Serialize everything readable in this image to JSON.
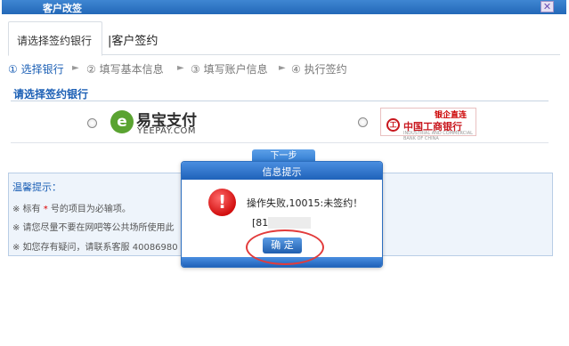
{
  "window": {
    "title": "客户改签",
    "close_glyph": "✕"
  },
  "tabs": [
    {
      "label": "请选择签约银行"
    },
    {
      "label": "|客户签约"
    }
  ],
  "steps": [
    {
      "label": "① 选择银行"
    },
    {
      "label": "② 填写基本信息"
    },
    {
      "label": "③ 填写账户信息"
    },
    {
      "label": "④ 执行签约"
    }
  ],
  "step_arrow": "►",
  "bank_section": {
    "title": "请选择签约银行"
  },
  "banks": [
    {
      "logo_mark": "e",
      "name": "易宝支付",
      "sub": "YEEPAY.COM"
    },
    {
      "top_tag": "银企直连",
      "logo_mark": "工",
      "name": "中国工商银行",
      "sub": "INDUSTRIAL AND COMMERCIAL BANK OF CHINA"
    }
  ],
  "next_button": "下一步",
  "tips": {
    "title": "温馨提示：",
    "lines": [
      {
        "prefix": "※ 标有",
        "star": " * ",
        "suffix": "号的项目为必输项。"
      },
      {
        "text": "※ 请您尽量不要在网吧等公共场所使用此"
      },
      {
        "text": "※ 如您存有疑问，请联系客服 40086980"
      }
    ]
  },
  "dialog": {
    "title": "信息提示",
    "icon_glyph": "!",
    "message": "操作失败,10015:未签约！",
    "detail": "[81",
    "ok_label": "确  定"
  }
}
